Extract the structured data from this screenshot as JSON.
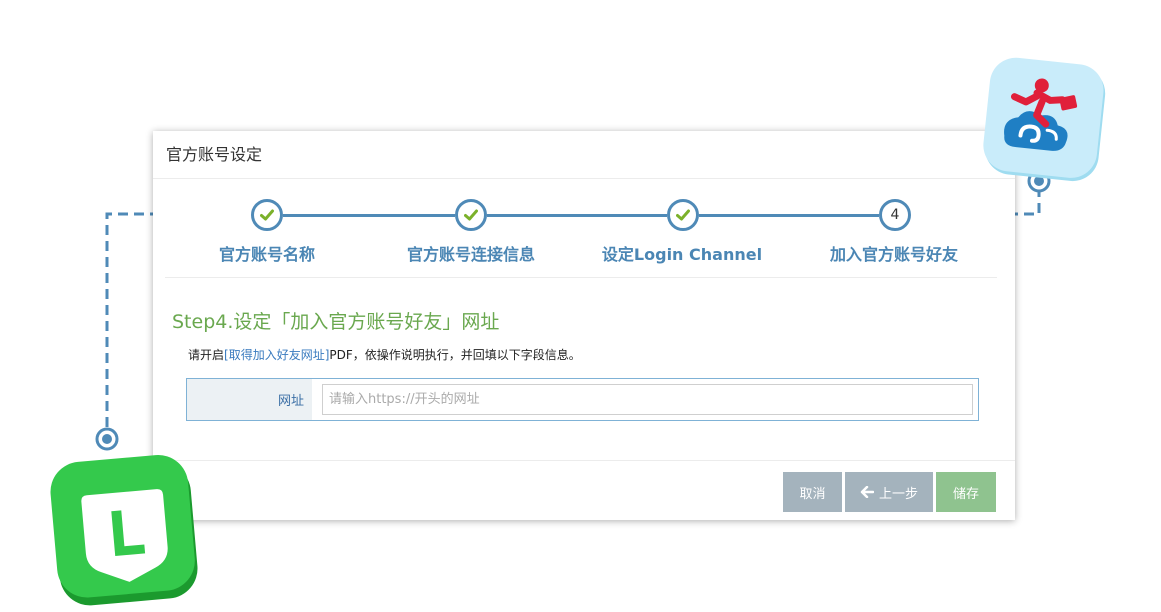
{
  "dialog": {
    "title": "官方账号设定"
  },
  "steps": [
    {
      "label": "官方账号名称",
      "status": "completed"
    },
    {
      "label": "官方账号连接信息",
      "status": "completed"
    },
    {
      "label": "设定Login Channel",
      "status": "completed"
    },
    {
      "label": "加入官方账号好友",
      "status": "current",
      "number": "4"
    }
  ],
  "content": {
    "heading": "Step4.设定「加入官方账号好友」网址",
    "instruction_prefix": "请开启",
    "instruction_link": "[取得加入好友网址]",
    "instruction_suffix": "PDF，依操作说明执行，并回填以下字段信息。"
  },
  "form": {
    "url_label": "网址",
    "url_value": "",
    "url_placeholder": "请输入https://开头的网址"
  },
  "buttons": {
    "cancel": "取消",
    "prev": "上一步",
    "save": "储存"
  },
  "icons": {
    "step_check": "check-icon",
    "prev": "arrow-left-icon",
    "line_app": "line-l-shield-icon",
    "mascot_app": "mascot-cloud-runner-icon"
  },
  "colors": {
    "accent_blue": "#4f8ab7",
    "step_label": "#4b86b4",
    "heading_green": "#6aa84f",
    "check_green": "#7bb12a",
    "button_gray": "#a4b3bd",
    "button_green": "#8fc38f",
    "line_app_green": "#34c94c"
  }
}
